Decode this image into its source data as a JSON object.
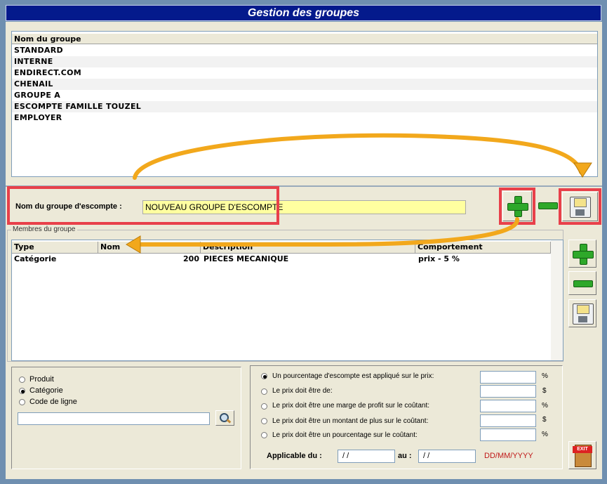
{
  "title": "Gestion des groupes",
  "group_list": {
    "header": "Nom du groupe",
    "rows": [
      "STANDARD",
      "INTERNE",
      "ENDIRECT.COM",
      "CHENAIL",
      "GROUPE A",
      "ESCOMPTE FAMILLE TOUZEL",
      "EMPLOYER"
    ]
  },
  "name_row": {
    "label": "Nom du groupe d'escompte :",
    "value": "NOUVEAU GROUPE D'ESCOMPTE"
  },
  "members": {
    "legend": "Membres du groupe",
    "columns": [
      "Type",
      "Nom",
      "Description",
      "Comportement"
    ],
    "rows": [
      {
        "type": "Catégorie",
        "nom": "200",
        "description": "PIECES MECANIQUE",
        "comportement": "prix - 5 %"
      }
    ]
  },
  "filter": {
    "options": [
      "Produit",
      "Catégorie",
      "Code de ligne"
    ],
    "selected": "Catégorie",
    "search_value": ""
  },
  "pricing": {
    "options": [
      {
        "label": "Un pourcentage d'escompte est appliqué sur le prix:",
        "unit": "%",
        "selected": true
      },
      {
        "label": "Le prix doit être de:",
        "unit": "$",
        "selected": false
      },
      {
        "label": "Le prix doit être une marge de profit sur le coûtant:",
        "unit": "%",
        "selected": false
      },
      {
        "label": "Le prix doit être un montant de plus sur le coûtant:",
        "unit": "$",
        "selected": false
      },
      {
        "label": "Le prix doit être un pourcentage sur le coûtant:",
        "unit": "%",
        "selected": false
      }
    ],
    "applicable_label": "Applicable du :",
    "date_from": " / /",
    "to_label": "au :",
    "date_to": " / /",
    "date_format": "DD/MM/YYYY"
  },
  "buttons": {
    "exit_label": "EXIT"
  },
  "colors": {
    "title_bar": "#041a8c",
    "highlight_box": "#e8404a",
    "arrow": "#f2a81c",
    "input_bg": "#ffffa0"
  }
}
